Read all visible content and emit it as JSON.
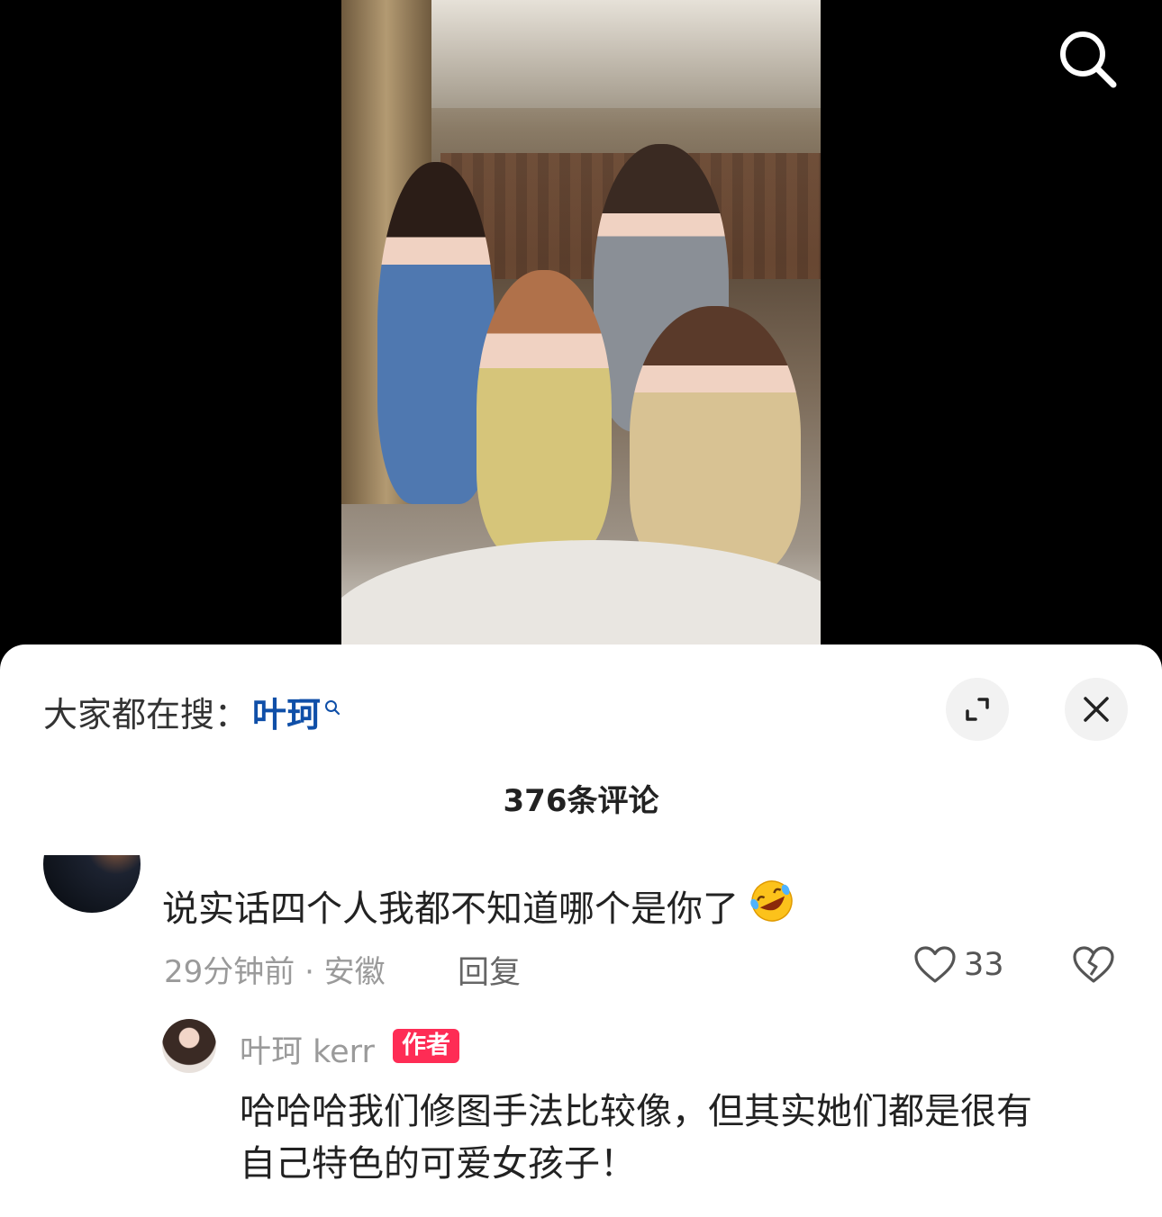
{
  "hot_search": {
    "prefix": "大家都在搜：",
    "term": "叶珂"
  },
  "comments_header": {
    "count_label": "376条评论"
  },
  "comment": {
    "text": "说实话四个人我都不知道哪个是你了",
    "emoji": "rolling-laughing-emoji",
    "time_location": "29分钟前 · 安徽",
    "reply_label": "回复",
    "like_count": "33"
  },
  "reply": {
    "author": "叶珂 kerr",
    "badge": "作者",
    "text_line1": "哈哈哈我们修图手法比较像，但其实她们都是很有",
    "text_line2": "自己特色的可爱女孩子！"
  },
  "colors": {
    "accent_link": "#0f4fa8",
    "author_badge": "#fe2c55"
  }
}
